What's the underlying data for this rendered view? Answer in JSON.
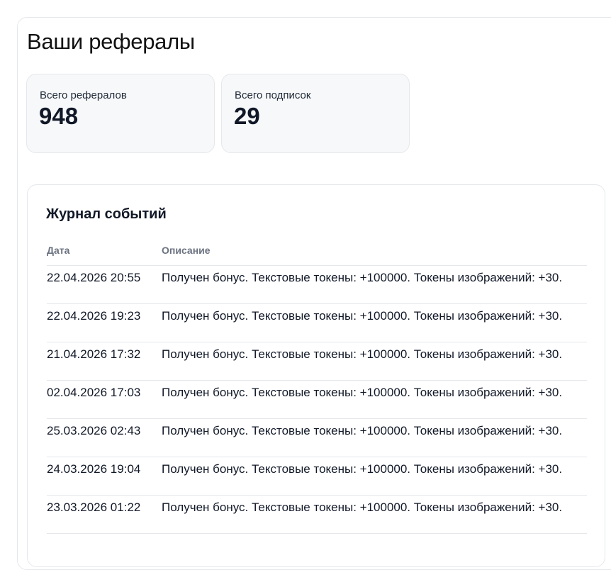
{
  "page": {
    "title": "Ваши рефералы"
  },
  "stats": [
    {
      "label": "Всего рефералов",
      "value": "948"
    },
    {
      "label": "Всего подписок",
      "value": "29"
    }
  ],
  "event_log": {
    "title": "Журнал событий",
    "columns": {
      "date": "Дата",
      "description": "Описание"
    },
    "rows": [
      {
        "date": "22.04.2026 20:55",
        "description": "Получен бонус. Текстовые токены: +100000. Токены изображений: +30."
      },
      {
        "date": "22.04.2026 19:23",
        "description": "Получен бонус. Текстовые токены: +100000. Токены изображений: +30."
      },
      {
        "date": "21.04.2026 17:32",
        "description": "Получен бонус. Текстовые токены: +100000. Токены изображений: +30."
      },
      {
        "date": "02.04.2026 17:03",
        "description": "Получен бонус. Текстовые токены: +100000. Токены изображений: +30."
      },
      {
        "date": "25.03.2026 02:43",
        "description": "Получен бонус. Текстовые токены: +100000. Токены изображений: +30."
      },
      {
        "date": "24.03.2026 19:04",
        "description": "Получен бонус. Текстовые токены: +100000. Токены изображений: +30."
      },
      {
        "date": "23.03.2026 01:22",
        "description": "Получен бонус. Текстовые токены: +100000. Токены изображений: +30."
      }
    ]
  }
}
